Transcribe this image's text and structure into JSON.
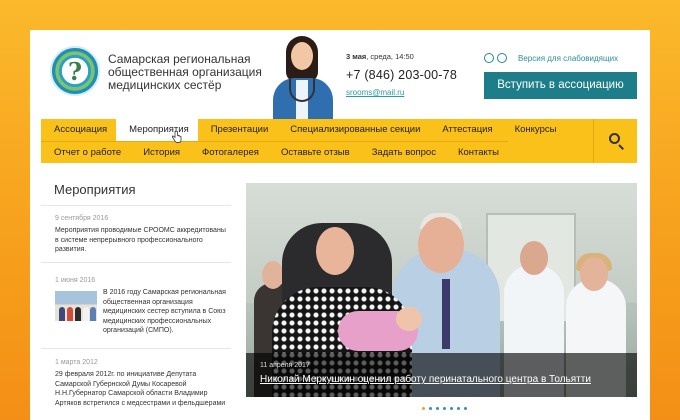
{
  "header": {
    "org_name": "Самарская региональная общественная организация медицинских сестёр",
    "date_bold": "3 мая",
    "date_rest": ", среда, 14:50",
    "phone": "+7 (846) 203-00-78",
    "email": "srooms@mail.ru",
    "vision_label": "Версия для слабовидящих",
    "join_label": "Вступить в ассоциацию",
    "logo_glyph": "?"
  },
  "nav": {
    "row1": [
      "Ассоциация",
      "Мероприятия",
      "Презентации",
      "Специализированные секции",
      "Аттестация",
      "Конкурсы"
    ],
    "row2": [
      "Отчет о работе",
      "История",
      "Фотогалерея",
      "Оставьте отзыв",
      "Задать вопрос",
      "Контакты"
    ],
    "active": "Мероприятия"
  },
  "sidebar": {
    "title": "Мероприятия",
    "news": [
      {
        "date": "9 сентября 2016",
        "text": "Мероприятия проводимые СРООМС аккредитованы в системе непрерывного профессионального развития."
      },
      {
        "date": "1 июня 2016",
        "text": "В 2016 году Самарская региональная общественная организация медицинских сестер вступила в Союз медицинских профессиональных организаций (СМПО)."
      },
      {
        "date": "1 марта 2012",
        "text": "29 февраля 2012г. по инициативе Депутата Самарской Губернской Думы Косаревой Н.Н.Губернатор Самарской области Владимир Артяков встретился с медсестрами и фельдшерами"
      }
    ]
  },
  "slider": {
    "date": "11 апреля 2017",
    "title": "Николай Меркушкин оценил работу перинатального центра в Тольятти",
    "dots_total": 7,
    "dots_active": 0
  },
  "colors": {
    "accent_yellow": "#fbc11b",
    "teal": "#1d7e89",
    "background_orange": "#f7a11d"
  },
  "icons": {
    "vision": "glasses-icon",
    "search": "search-icon",
    "cursor": "hand-cursor-icon"
  }
}
